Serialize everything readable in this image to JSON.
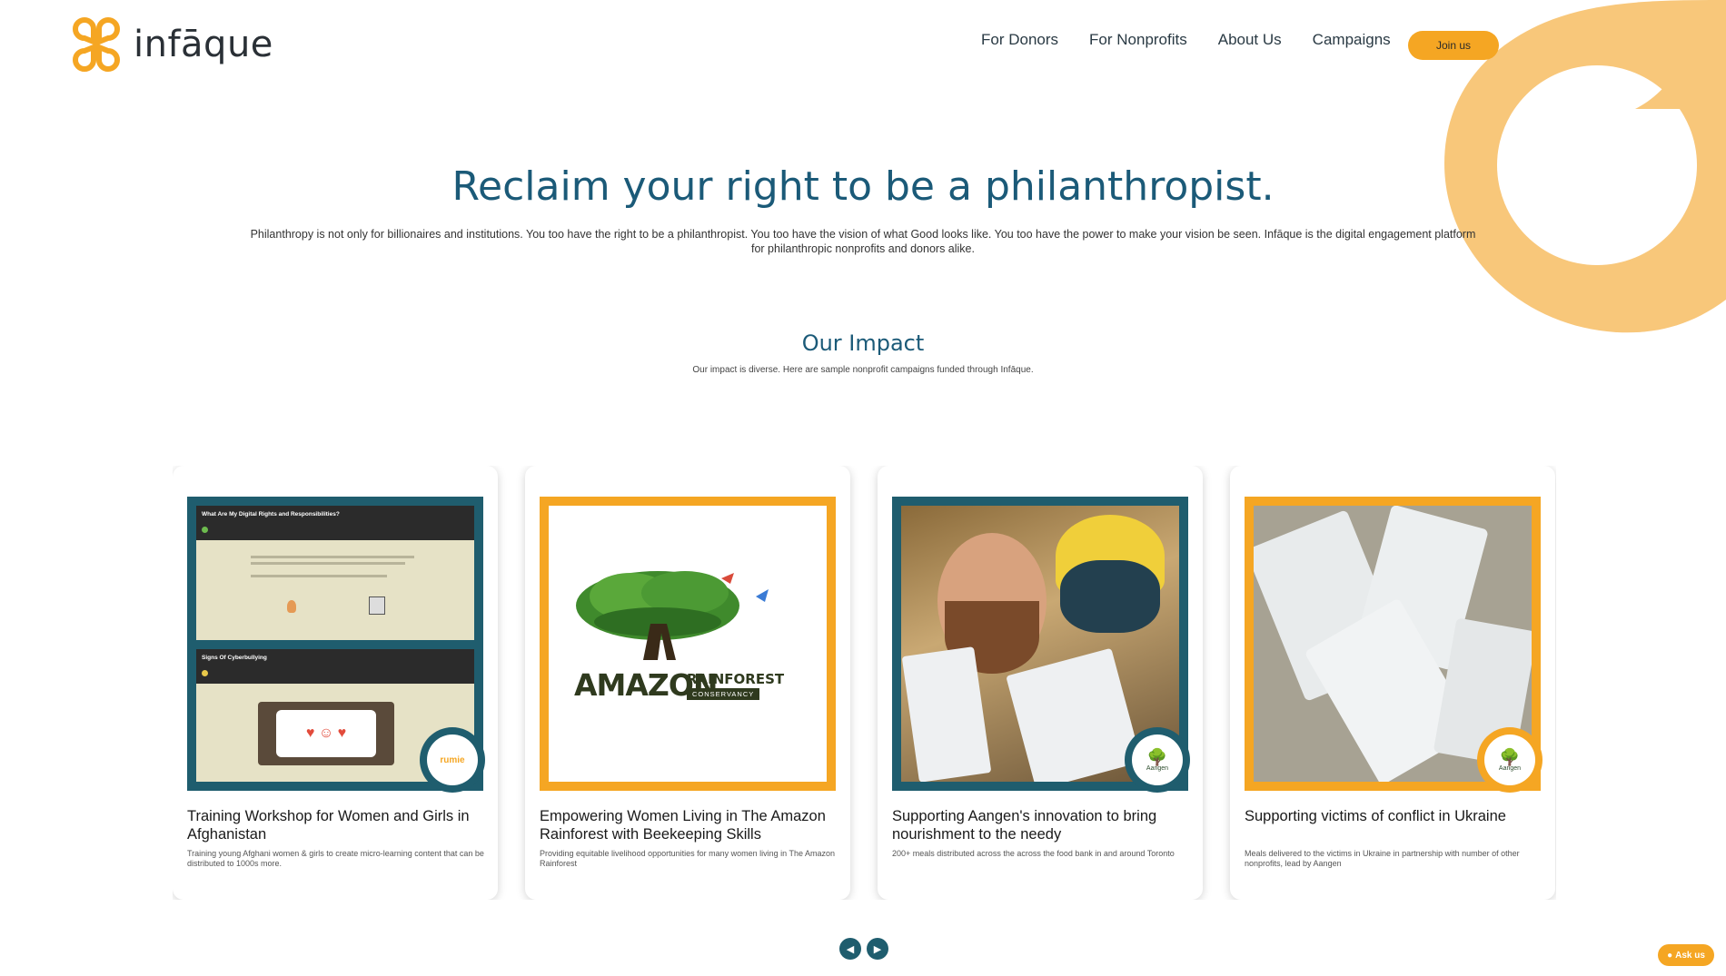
{
  "brand": {
    "name": "infāque",
    "accent": "#f5a623",
    "teal": "#1f5d6e",
    "title_color": "#1b5a78"
  },
  "nav": {
    "items": [
      "For Donors",
      "For Nonprofits",
      "About Us",
      "Campaigns"
    ],
    "join_label": "Join us"
  },
  "hero": {
    "title": "Reclaim your right to be a philanthropist.",
    "text": "Philanthropy is not only for billionaires and institutions. You too have the right to be a philanthropist. You too have the vision of what Good looks like. You too have the power to make your vision be seen. Infāque is the digital engagement platform for philanthropic nonprofits and donors alike."
  },
  "impact": {
    "title": "Our Impact",
    "subtitle": "Our impact is diverse. Here are sample nonprofit campaigns funded through Infāque."
  },
  "cards": [
    {
      "title": "Training Workshop for Women and Girls in Afghanistan",
      "desc": "Training young Afghani women & girls to create micro-learning content that can be distributed to 1000s more.",
      "screen_title_1": "What Are My Digital Rights and Responsibilities?",
      "screen_title_2": "Signs Of Cyberbullying",
      "badge_text": "rumie"
    },
    {
      "title": "Empowering Women Living in The Amazon Rainforest with Beekeeping Skills",
      "desc": "Providing equitable livelihood opportunities for many women living in The Amazon Rainforest",
      "logo_word_1": "AMAZON",
      "logo_word_2": "RAINFOREST",
      "logo_word_3": "CONSERVANCY"
    },
    {
      "title": "Supporting Aangen's innovation to bring nourishment to the needy",
      "desc": "200+ meals distributed across the across the food bank in and around Toronto",
      "badge_text": "Aangen"
    },
    {
      "title": "Supporting victims of conflict in Ukraine",
      "desc": "Meals delivered to the victims in Ukraine in partnership with number of other nonprofits, lead by Aangen",
      "badge_text": "Aangen"
    }
  ],
  "carousel": {
    "prev_icon": "◀",
    "next_icon": "▶"
  },
  "chat": {
    "label": "Ask us"
  }
}
